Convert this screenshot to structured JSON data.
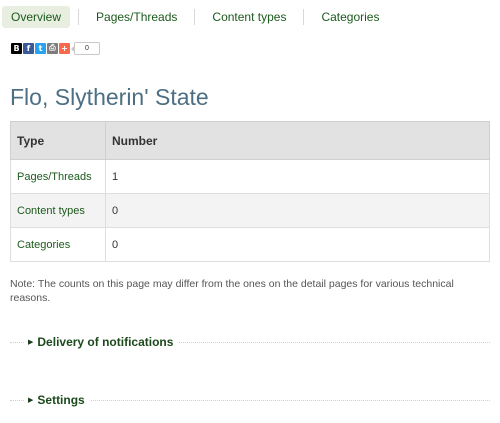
{
  "tabs": [
    {
      "label": "Overview",
      "active": true
    },
    {
      "label": "Pages/Threads"
    },
    {
      "label": "Content types"
    },
    {
      "label": "Categories"
    }
  ],
  "share": {
    "buttons": [
      "bookmark-icon",
      "facebook-icon",
      "twitter-icon",
      "print-icon",
      "plus-icon"
    ],
    "count": "0"
  },
  "page_title": "Flo, Slytherin' State",
  "table": {
    "headers": [
      "Type",
      "Number"
    ],
    "rows": [
      {
        "type": "Pages/Threads",
        "number": "1"
      },
      {
        "type": "Content types",
        "number": "0"
      },
      {
        "type": "Categories",
        "number": "0"
      }
    ]
  },
  "note": "Note: The counts on this page may differ from the ones on the detail pages for various technical reasons.",
  "sections": [
    {
      "label": "Delivery of notifications"
    },
    {
      "label": "Settings"
    }
  ],
  "colors": {
    "link": "#1c5a1c",
    "title": "#4d6f83",
    "header_bg": "#e2e2e2"
  }
}
